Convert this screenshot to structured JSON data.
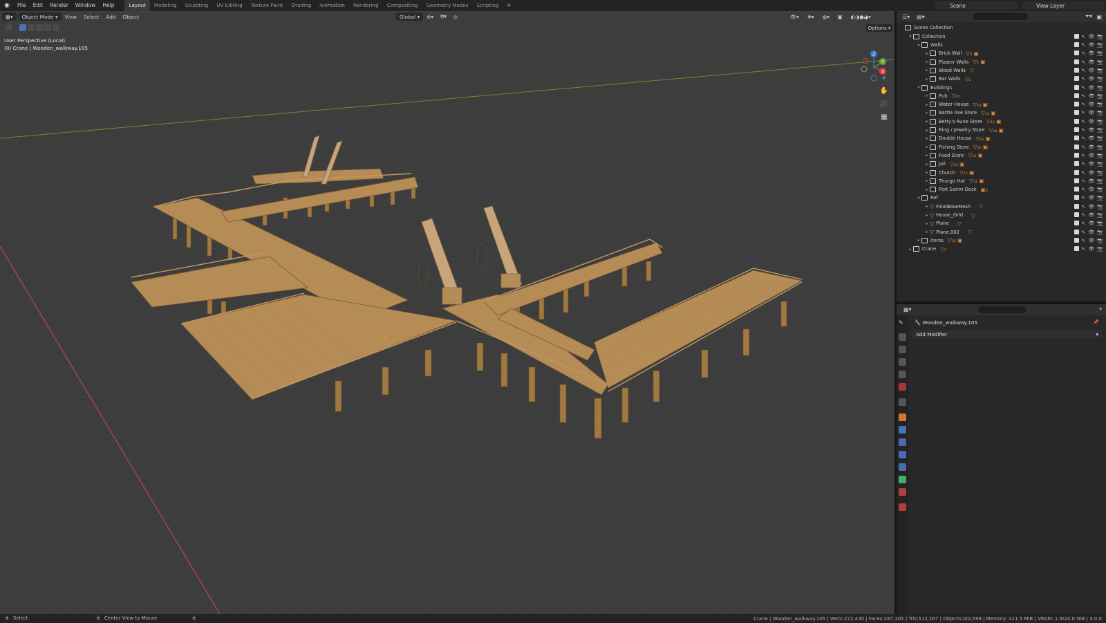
{
  "app": {
    "menus": [
      "File",
      "Edit",
      "Render",
      "Window",
      "Help"
    ],
    "workspaces": [
      "Layout",
      "Modeling",
      "Sculpting",
      "UV Editing",
      "Texture Paint",
      "Shading",
      "Animation",
      "Rendering",
      "Compositing",
      "Geometry Nodes",
      "Scripting"
    ],
    "active_workspace": "Layout",
    "scene": "Scene",
    "view_layer": "View Layer"
  },
  "viewport": {
    "mode": "Object Mode",
    "menus": [
      "View",
      "Select",
      "Add",
      "Object"
    ],
    "transform": "Global",
    "options": "Options",
    "perspective": "User Perspective (Local)",
    "context": "(0) Crane | Wooden_walkway.105",
    "gizmo": {
      "x": "X",
      "y": "Y",
      "z": "Z"
    }
  },
  "outliner": {
    "root": "Scene Collection",
    "rows": [
      {
        "label": "Collection",
        "depth": 1,
        "kind": "coll",
        "open": true
      },
      {
        "label": "Walls",
        "depth": 2,
        "kind": "coll",
        "open": true
      },
      {
        "label": "Brick Wall",
        "depth": 3,
        "kind": "coll",
        "tags": "▽₃ ▣"
      },
      {
        "label": "Plaster Walls",
        "depth": 3,
        "kind": "coll",
        "tags": "▽₂ ▣"
      },
      {
        "label": "Wood Walls",
        "depth": 3,
        "kind": "coll",
        "tags": "▽"
      },
      {
        "label": "Bar Walls",
        "depth": 3,
        "kind": "coll",
        "tags": "▽₂"
      },
      {
        "label": "Buildings",
        "depth": 2,
        "kind": "coll",
        "open": true
      },
      {
        "label": "Pub",
        "depth": 3,
        "kind": "coll",
        "tags": "▽₆₅"
      },
      {
        "label": "Water House",
        "depth": 3,
        "kind": "coll",
        "tags": "▽₁₉ ▣"
      },
      {
        "label": "Battle Axe Store",
        "depth": 3,
        "kind": "coll",
        "tags": "▽₁₃ ▣"
      },
      {
        "label": "Betty's Rune Store",
        "depth": 3,
        "kind": "coll",
        "tags": "▽₁₂ ▣"
      },
      {
        "label": "Ring / Jewelry Store",
        "depth": 3,
        "kind": "coll",
        "tags": "▽₁₄ ▣"
      },
      {
        "label": "Double House",
        "depth": 3,
        "kind": "coll",
        "tags": "▽₂₀ ▣"
      },
      {
        "label": "Fishing Store",
        "depth": 3,
        "kind": "coll",
        "tags": "▽₁₆ ▣"
      },
      {
        "label": "Food Store",
        "depth": 3,
        "kind": "coll",
        "tags": "▽₁₃ ▣"
      },
      {
        "label": "Jail",
        "depth": 3,
        "kind": "coll",
        "tags": "▽₂₅ ▣"
      },
      {
        "label": "Church",
        "depth": 3,
        "kind": "coll",
        "tags": "▽₁₅ ▣"
      },
      {
        "label": "Thurgo Hut",
        "depth": 3,
        "kind": "coll",
        "tags": "▽₁₂ ▣"
      },
      {
        "label": "Port Sarim Dock",
        "depth": 3,
        "kind": "coll",
        "tags": "▣₃"
      },
      {
        "label": "Ref",
        "depth": 2,
        "kind": "coll",
        "open": true
      },
      {
        "label": "FinalBaseMesh",
        "depth": 3,
        "kind": "mesh",
        "green": true
      },
      {
        "label": "House_Grid",
        "depth": 3,
        "kind": "mesh",
        "green": true
      },
      {
        "label": "Plane",
        "depth": 3,
        "kind": "mesh",
        "green": true
      },
      {
        "label": "Plane.002",
        "depth": 3,
        "kind": "mesh",
        "green": true
      },
      {
        "label": "Items",
        "depth": 2,
        "kind": "coll",
        "tags": "▽₃₃ ▣"
      },
      {
        "label": "Crane",
        "depth": 1,
        "kind": "coll",
        "tags": "▽₅"
      }
    ]
  },
  "properties": {
    "object_name": "Wooden_walkway.105",
    "add_modifier": "Add Modifier"
  },
  "statusbar": {
    "left": "Select",
    "middle": "Center View to Mouse",
    "right": "Crane | Wooden_walkway.105 | Verts:272,430 | Faces:287,105 | Tris:512,167 | Objects:0/2,598 | Memory: 411.5 MiB | VRAM: 1.9/24.0 GiB | 3.0.0"
  },
  "colors": {
    "wood": "#b58b56",
    "wood_dark": "#8a6638",
    "grid": "#464646",
    "x_axis": "#c04a4a",
    "y_axis": "#7a9a3a",
    "accent": "#4772b3"
  }
}
